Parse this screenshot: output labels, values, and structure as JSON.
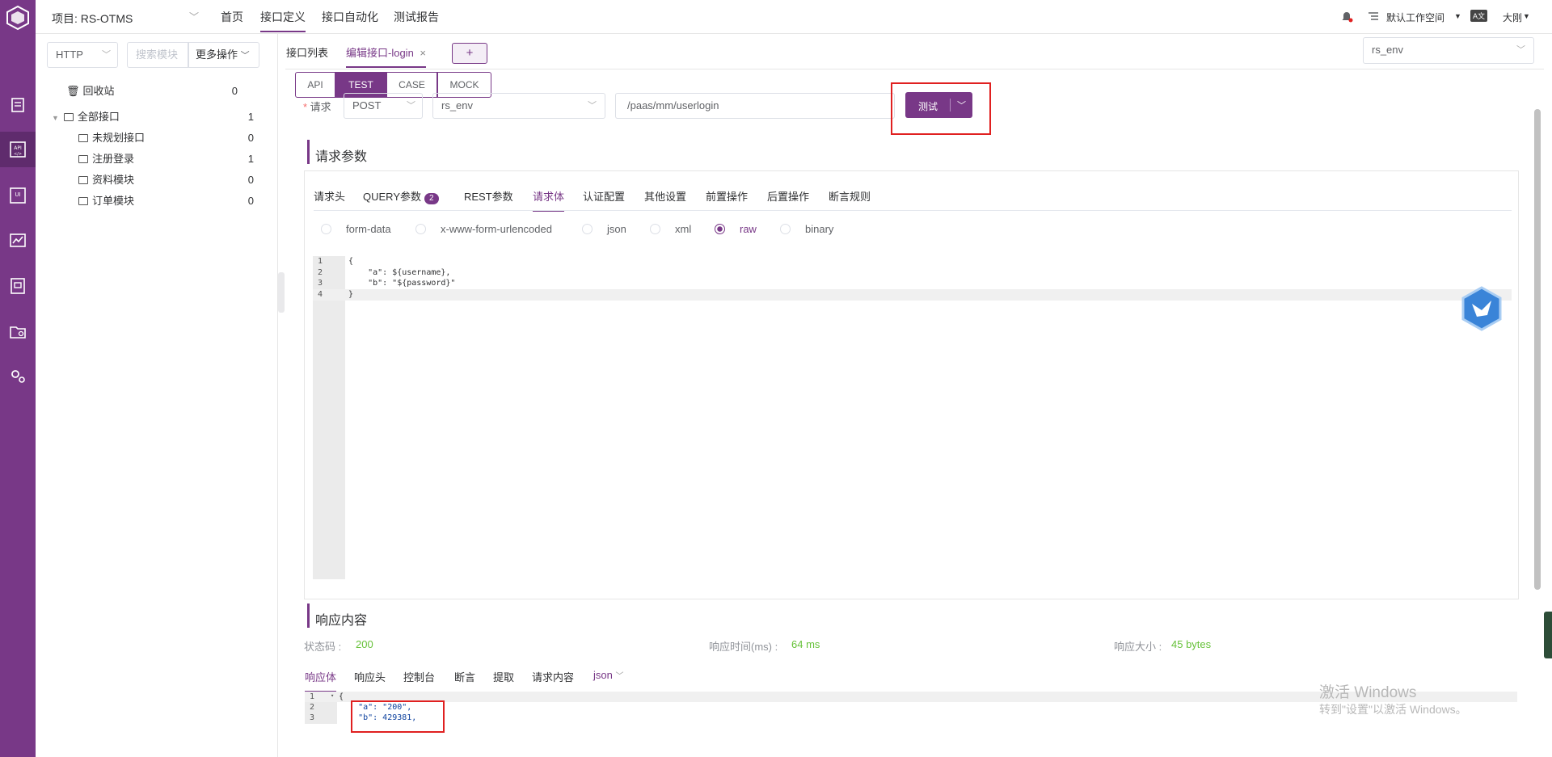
{
  "colors": {
    "brand": "#783887",
    "accent_green": "#67c23a",
    "highlight_red": "#e02020"
  },
  "topbar": {
    "project_label": "项目: RS-OTMS",
    "nav": [
      "首页",
      "接口定义",
      "接口自动化",
      "测试报告"
    ],
    "workspace": "默认工作空间",
    "lang_badge": "A文",
    "user": "大刚"
  },
  "sidebar": {
    "protocol": "HTTP",
    "search_placeholder": "搜索模块",
    "more_ops": "更多操作",
    "recycle": {
      "label": "回收站",
      "count": "0"
    },
    "all": {
      "label": "全部接口",
      "count": "1"
    },
    "modules": [
      {
        "label": "未规划接口",
        "count": "0"
      },
      {
        "label": "注册登录",
        "count": "1"
      },
      {
        "label": "资料模块",
        "count": "0"
      },
      {
        "label": "订单模块",
        "count": "0"
      }
    ]
  },
  "tabs": {
    "list": "接口列表",
    "edit": "编辑接口-login",
    "add": "+"
  },
  "env_select": "rs_env",
  "modes": [
    "API",
    "TEST",
    "CASE",
    "MOCK"
  ],
  "request": {
    "label": "请求",
    "method": "POST",
    "env": "rs_env",
    "path": "/paas/mm/userlogin",
    "test_button": "测试"
  },
  "params": {
    "title": "请求参数",
    "tabs": [
      "请求头",
      "QUERY参数",
      "REST参数",
      "请求体",
      "认证配置",
      "其他设置",
      "前置操作",
      "后置操作",
      "断言规则"
    ],
    "query_badge": "2",
    "body_types": [
      "form-data",
      "x-www-form-urlencoded",
      "json",
      "xml",
      "raw",
      "binary"
    ],
    "code_lines": [
      "{",
      "    \"a\": ${username},",
      "    \"b\": \"${password}\"",
      "}"
    ],
    "line_numbers": [
      "1",
      "2",
      "3",
      "4"
    ]
  },
  "response": {
    "title": "响应内容",
    "status_label": "状态码 :",
    "status_value": "200",
    "time_label": "响应时间(ms) :",
    "time_value": "64 ms",
    "size_label": "响应大小 :",
    "size_value": "45 bytes",
    "tabs": [
      "响应体",
      "响应头",
      "控制台",
      "断言",
      "提取",
      "请求内容"
    ],
    "format": "json",
    "code_lines": [
      "{",
      "    \"a\": \"200\",",
      "    \"b\": 429381,"
    ],
    "line_numbers": [
      "1",
      "2",
      "3"
    ]
  },
  "watermark": {
    "line1": "激活 Windows",
    "line2": "转到\"设置\"以激活 Windows。"
  }
}
